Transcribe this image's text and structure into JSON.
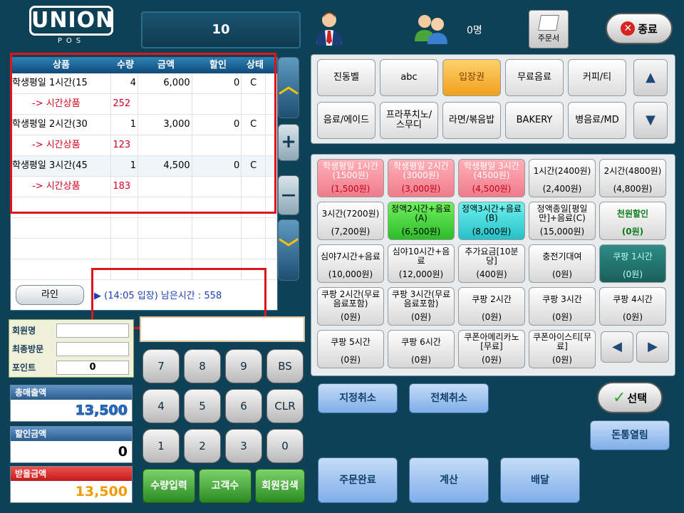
{
  "header": {
    "logo_text": "UNION",
    "logo_sub": "POS",
    "table_number": "10",
    "guest_count": "0명",
    "order_slip_label": "주문서",
    "exit_label": "종료"
  },
  "orders": {
    "columns": [
      "상품",
      "수량",
      "금액",
      "할인",
      "상태"
    ],
    "rows": [
      {
        "name": "학생평일 1시간(15",
        "qty": "4",
        "amount": "6,000",
        "discount": "0",
        "status": "C"
      },
      {
        "name": "-> 시간상품",
        "qty": "252",
        "amount": "",
        "discount": "",
        "status": ""
      },
      {
        "name": "학생평일 2시간(30",
        "qty": "1",
        "amount": "3,000",
        "discount": "0",
        "status": "C"
      },
      {
        "name": "-> 시간상품",
        "qty": "123",
        "amount": "",
        "discount": "",
        "status": ""
      },
      {
        "name": "학생평일 3시간(45",
        "qty": "1",
        "amount": "4,500",
        "discount": "0",
        "status": "C"
      },
      {
        "name": "-> 시간상품",
        "qty": "183",
        "amount": "",
        "discount": "",
        "status": ""
      }
    ],
    "line_button": "라인",
    "time_info": "▶ (14:05 입장) 남은시간 : 558"
  },
  "scroll": {
    "plus": "+",
    "minus": "—"
  },
  "member": {
    "name_label": "회원명",
    "last_visit_label": "최종방문",
    "point_label": "포인트",
    "name_value": "",
    "last_visit_value": "",
    "point_value": "0"
  },
  "totals": {
    "total_label": "총매출액",
    "total_value": "13,500",
    "discount_label": "할인금액",
    "discount_value": "0",
    "receive_label": "받을금액",
    "receive_value": "13,500"
  },
  "keypad": {
    "keys": [
      "7",
      "8",
      "9",
      "BS",
      "4",
      "5",
      "6",
      "CLR",
      "1",
      "2",
      "3",
      "0"
    ],
    "green": [
      "수량입력",
      "고객수",
      "회원검색"
    ]
  },
  "categories": [
    "진동벨",
    "abc",
    "입장권",
    "무료음료",
    "커피/티",
    "음료/에이드",
    "프라푸치노/스무디",
    "라면/볶음밥",
    "BAKERY",
    "병음료/MD"
  ],
  "products": [
    {
      "name": "학생평일 1시간(1500원)",
      "price": "(1,500원)",
      "style": "pink"
    },
    {
      "name": "학생평일 2시간(3000원)",
      "price": "(3,000원)",
      "style": "pink"
    },
    {
      "name": "학생평일 3시간(4500원)",
      "price": "(4,500원)",
      "style": "pink"
    },
    {
      "name": "1시간(2400원)",
      "price": "(2,400원)",
      "style": ""
    },
    {
      "name": "2시간(4800원)",
      "price": "(4,800원)",
      "style": ""
    },
    {
      "name": "3시간(7200원)",
      "price": "(7,200원)",
      "style": ""
    },
    {
      "name": "정액2시간+음료(A)",
      "price": "(6,500원)",
      "style": "green"
    },
    {
      "name": "정액3시간+음료(B)",
      "price": "(8,000원)",
      "style": "cyan"
    },
    {
      "name": "정액종일[평일만]+음료(C)",
      "price": "(15,000원)",
      "style": ""
    },
    {
      "name": "천원할인",
      "price": "(0원)",
      "style": "greenlbl"
    },
    {
      "name": "심야7시간+음료",
      "price": "(10,000원)",
      "style": ""
    },
    {
      "name": "심야10시간+음료",
      "price": "(12,000원)",
      "style": ""
    },
    {
      "name": "추가요금[10분당]",
      "price": "(400원)",
      "style": ""
    },
    {
      "name": "충전기대여",
      "price": "(0원)",
      "style": ""
    },
    {
      "name": "쿠팡 1시간",
      "price": "(0원)",
      "style": "teal"
    },
    {
      "name": "쿠팡 2시간(무료음료포함)",
      "price": "(0원)",
      "style": ""
    },
    {
      "name": "쿠팡 3시간(무료음료포함)",
      "price": "(0원)",
      "style": ""
    },
    {
      "name": "쿠팡 2시간",
      "price": "(0원)",
      "style": ""
    },
    {
      "name": "쿠팡 3시간",
      "price": "(0원)",
      "style": ""
    },
    {
      "name": "쿠팡 4시간",
      "price": "(0원)",
      "style": ""
    },
    {
      "name": "쿠팡 5시간",
      "price": "(0원)",
      "style": ""
    },
    {
      "name": "쿠팡 6시간",
      "price": "(0원)",
      "style": ""
    },
    {
      "name": "쿠폰아메리카노[무료]",
      "price": "(0원)",
      "style": ""
    },
    {
      "name": "쿠폰아이스티[무료]",
      "price": "(0원)",
      "style": ""
    }
  ],
  "actions": {
    "cancel_selected": "지정취소",
    "cancel_all": "전체취소",
    "select": "선택",
    "open_drawer": "돈통열림",
    "order_complete": "주문완료",
    "pay": "계산",
    "delivery": "배달"
  }
}
